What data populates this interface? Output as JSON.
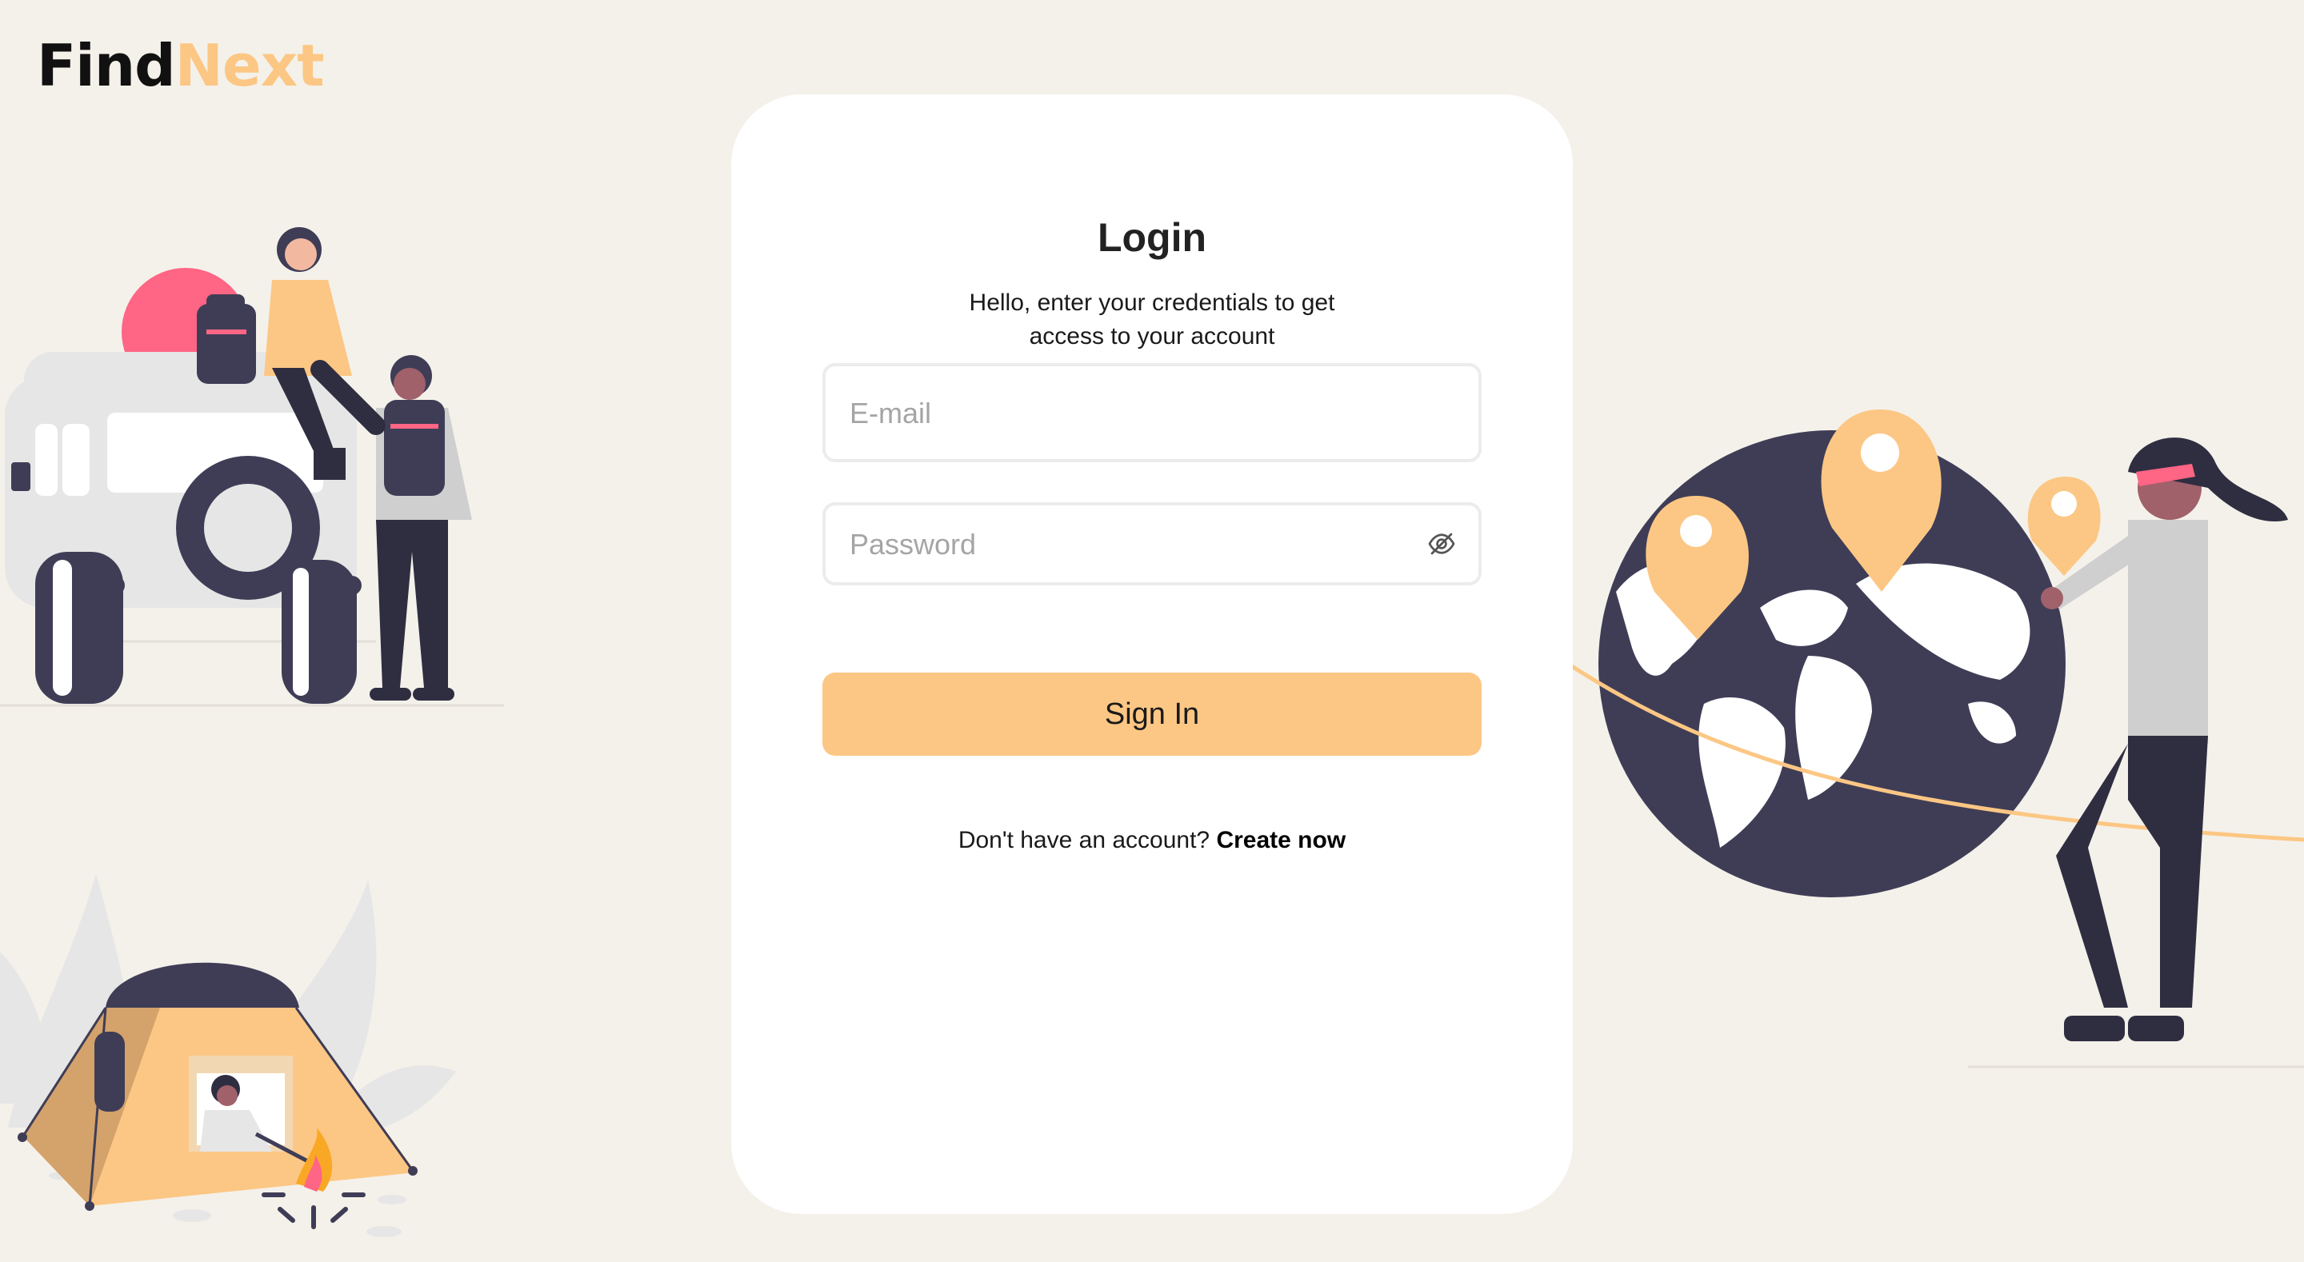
{
  "brand": {
    "name_part1": "Find",
    "name_part2": "Next",
    "accent_color": "#fcc784",
    "dark_color": "#111111"
  },
  "login": {
    "title": "Login",
    "subtitle": "Hello, enter your credentials to get access to your account",
    "email": {
      "placeholder": "E-mail",
      "value": ""
    },
    "password": {
      "placeholder": "Password",
      "value": "",
      "toggle_icon": "eye-slash-icon"
    },
    "submit_label": "Sign In",
    "signup_prompt": "Don't have an account?",
    "signup_link": "Create now"
  },
  "illustrations": [
    {
      "name": "travelers-jeep-illustration"
    },
    {
      "name": "camping-tent-illustration"
    },
    {
      "name": "globe-map-pins-illustration"
    }
  ],
  "colors": {
    "background": "#f4f1ea",
    "card": "#ffffff",
    "button": "#fcc784",
    "illustration_dark": "#3f3d56",
    "illustration_pink": "#ff6584"
  }
}
